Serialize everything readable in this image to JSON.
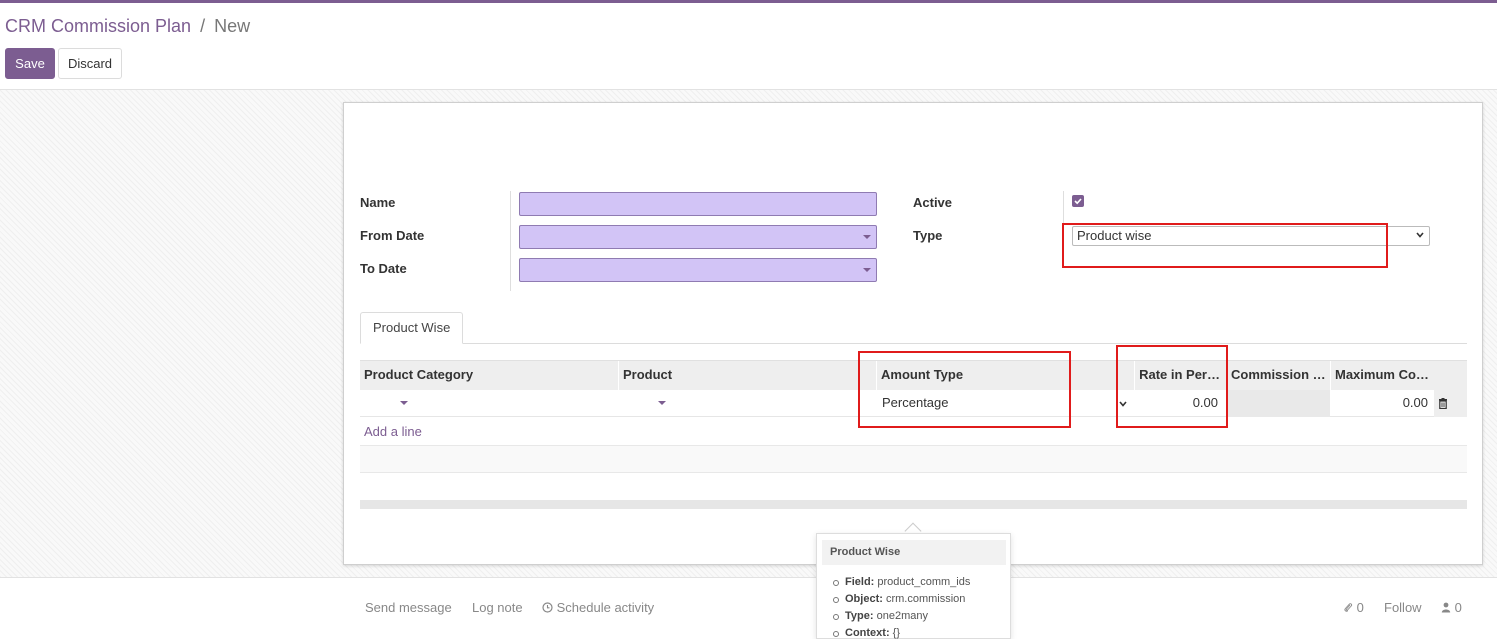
{
  "breadcrumb": {
    "parent": "CRM Commission Plan",
    "separator": "/",
    "current": "New"
  },
  "buttons": {
    "save": "Save",
    "discard": "Discard"
  },
  "form": {
    "name_label": "Name",
    "from_date_label": "From Date",
    "to_date_label": "To Date",
    "active_label": "Active",
    "active_checked": true,
    "type_label": "Type",
    "type_value": "Product wise"
  },
  "notebook": {
    "tabs": [
      {
        "label": "Product Wise"
      }
    ]
  },
  "table": {
    "columns": [
      "Product Category",
      "Product",
      "Amount Type",
      "Rate in Per…",
      "Commission …",
      "Maximum Co…"
    ],
    "rows": [
      {
        "product_category": "",
        "product": "",
        "amount_type": "Percentage",
        "rate": "0.00",
        "commission": "",
        "maximum": "0.00"
      }
    ],
    "add_line": "Add a line"
  },
  "chatter": {
    "send_message": "Send message",
    "log_note": "Log note",
    "schedule_activity": "Schedule activity",
    "attachments_count": "0",
    "follow": "Follow",
    "followers_count": "0"
  },
  "tooltip": {
    "title": "Product Wise",
    "field_label": "Field:",
    "field_value": "product_comm_ids",
    "object_label": "Object:",
    "object_value": "crm.commission",
    "type_label": "Type:",
    "type_value": "one2many",
    "context_label": "Context:",
    "context_value": "{}"
  },
  "colors": {
    "brand": "#7c5d91",
    "required_field": "#d2c4f6",
    "highlight": "#e01b1b"
  }
}
